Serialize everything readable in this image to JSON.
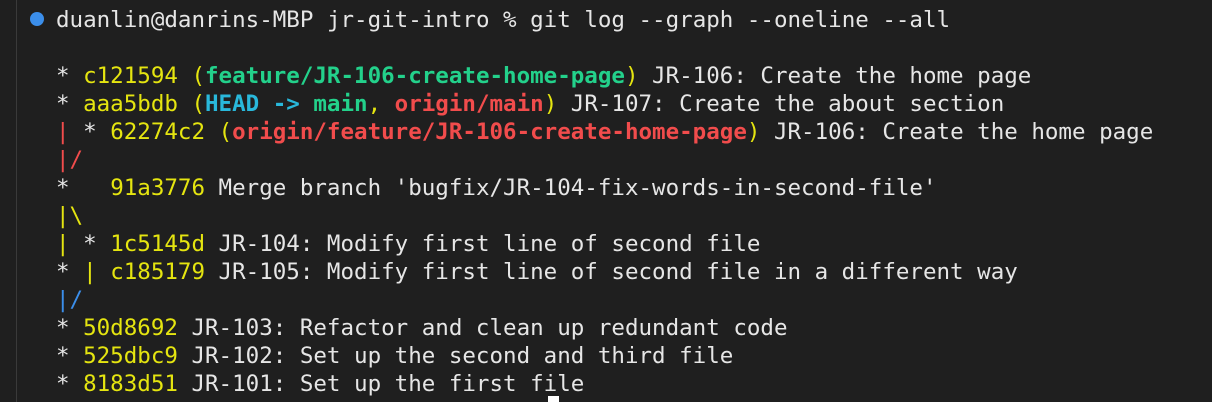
{
  "prompt": {
    "user_host": "duanlin@danrins-MBP",
    "directory": "jr-git-intro",
    "symbol": "%",
    "command": "git log --graph --oneline --all"
  },
  "log": [
    {
      "graph": "* ",
      "hash": "c121594",
      "refs_open": "(",
      "ref1": "feature/JR-106-create-home-page",
      "refs_close": ")",
      "message": " JR-106: Create the home page"
    },
    {
      "graph": "* ",
      "hash": "aaa5bdb",
      "refs_open": "(",
      "ref_head": "HEAD -> ",
      "ref_main": "main",
      "ref_sep": ", ",
      "ref_origin": "origin/main",
      "refs_close": ")",
      "message": " JR-107: Create the about section"
    },
    {
      "graph_bar": "| ",
      "graph": "* ",
      "hash": "62274c2",
      "refs_open": "(",
      "ref_origin": "origin/feature/JR-106-create-home-page",
      "refs_close": ")",
      "message": " JR-106: Create the home page"
    },
    {
      "graph_bar": "|/"
    },
    {
      "graph": "*   ",
      "hash": "91a3776",
      "message": " Merge branch 'bugfix/JR-104-fix-words-in-second-file'"
    },
    {
      "graph_bar": "|\\"
    },
    {
      "graph_bar": "| ",
      "graph": "* ",
      "hash": "1c5145d",
      "message": " JR-104: Modify first line of second file"
    },
    {
      "graph": "* ",
      "graph_bar2": "| ",
      "hash": "c185179",
      "message": " JR-105: Modify first line of second file in a different way"
    },
    {
      "graph_bar": "|/"
    },
    {
      "graph": "* ",
      "hash": "50d8692",
      "message": " JR-103: Refactor and clean up redundant code"
    },
    {
      "graph": "* ",
      "hash": "525dbc9",
      "message": " JR-102: Set up the second and third file"
    },
    {
      "graph": "* ",
      "hash": "8183d51",
      "message": " JR-101: Set up the first file"
    }
  ],
  "colors": {
    "background": "#1f1f1f",
    "hash": "#e5e510",
    "branch_local": "#23d18b",
    "branch_remote": "#f14c4c",
    "head": "#29b8db",
    "prompt_dot": "#3b8eea"
  }
}
